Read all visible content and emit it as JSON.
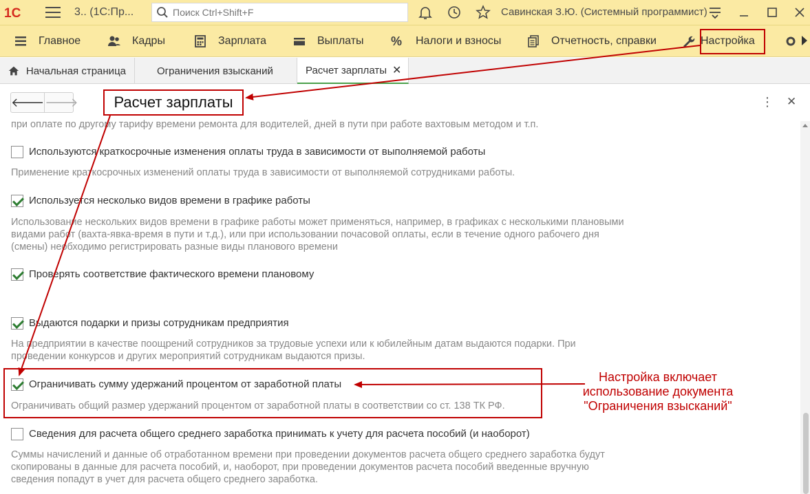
{
  "titlebar": {
    "logo_text": "1С",
    "title": "3.. (1С:Пр...",
    "search_placeholder": "Поиск Ctrl+Shift+F",
    "user": "Савинская З.Ю. (Системный программист)"
  },
  "menu": [
    {
      "label": "Главное",
      "icon": "menu-lines-icon"
    },
    {
      "label": "Кадры",
      "icon": "people-icon"
    },
    {
      "label": "Зарплата",
      "icon": "calculator-icon"
    },
    {
      "label": "Выплаты",
      "icon": "wallet-icon"
    },
    {
      "label": "Налоги и взносы",
      "icon": "percent-icon"
    },
    {
      "label": "Отчетность, справки",
      "icon": "documents-icon"
    },
    {
      "label": "Настройка",
      "icon": "wrench-icon"
    }
  ],
  "tabs": [
    {
      "label": "Начальная страница",
      "icon": "home-icon"
    },
    {
      "label": "Ограничения взысканий"
    },
    {
      "label": "Расчет зарплаты",
      "close": "✕"
    }
  ],
  "content": {
    "nav_back": "🡐",
    "nav_forward": "🡒",
    "partial_text": "при оплате по другому тарифу времени ремонта для водителей, дней в пути при работе вахтовым методом и т.п.",
    "settings": [
      {
        "label": "Используются краткосрочные изменения оплаты труда в зависимости от выполняемой работы",
        "checked": false,
        "description": "Применение краткосрочных изменений оплаты труда в зависимости от выполняемой сотрудниками работы."
      },
      {
        "label": "Используется несколько видов времени в графике работы",
        "checked": true,
        "description": "Использование нескольких видов времени в графике работы может применяться, например, в графиках с несколькими плановыми видами работ (вахта-явка-время в пути и т.д.), или при использовании почасовой оплаты, если в течение одного рабочего дня (смены) необходимо регистрировать разные виды планового времени"
      },
      {
        "label": "Проверять соответствие фактического времени плановому",
        "checked": true,
        "description": ""
      },
      {
        "label": "Выдаются подарки и призы сотрудникам предприятия",
        "checked": true,
        "description": "На предприятии в качестве поощрений сотрудников за трудовые успехи или к юбилейным датам выдаются подарки. При проведении конкурсов и других мероприятий сотрудникам выдаются призы."
      },
      {
        "label": "Ограничивать сумму удержаний процентом от заработной платы",
        "checked": true,
        "description": "Ограничивать общий размер удержаний процентом от заработной платы в соответствии со ст. 138 ТК РФ."
      },
      {
        "label": "Сведения для расчета общего среднего заработка принимать к учету для расчета пособий (и наоборот)",
        "checked": false,
        "description": "Суммы начислений и данные об отработанном времени при проведении документов расчета общего среднего заработка будут скопированы в данные для расчета пособий, и, наоборот, при проведении документов расчета пособий введенные вручную сведения попадут в учет для расчета общего среднего заработка."
      }
    ]
  },
  "annotations": {
    "callout": "Расчет зарплаты",
    "note": "Настройка включает использование документа \"Ограничения взысканий\"",
    "color": "#c00000"
  }
}
